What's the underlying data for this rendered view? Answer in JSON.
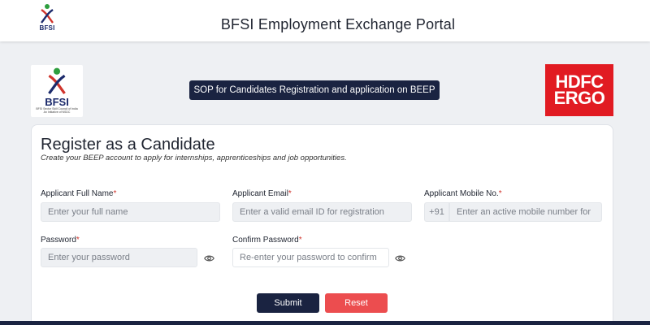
{
  "header": {
    "logo_text": "BFSI",
    "title": "BFSI Employment Exchange Portal"
  },
  "banner": {
    "bfsi_logo_text": "BFSI",
    "bfsi_tagline_line1": "BFSI Sector Skill Council of India",
    "bfsi_tagline_line2": "An Initiative of NSDC",
    "sop_label": "SOP for Candidates Registration and application on BEEP",
    "partner_logo_line1": "HDFC",
    "partner_logo_line2": "ERGO"
  },
  "form": {
    "title": "Register as a Candidate",
    "subtitle": "Create your BEEP account to apply for internships, apprenticeships and job opportunities.",
    "full_name": {
      "label": "Applicant Full Name",
      "placeholder": "Enter your full name",
      "value": ""
    },
    "email": {
      "label": "Applicant Email",
      "placeholder": "Enter a valid email ID for registration",
      "value": ""
    },
    "mobile": {
      "label": "Applicant Mobile No.",
      "prefix": "+91",
      "placeholder": "Enter an active mobile number for",
      "value": ""
    },
    "password": {
      "label": "Password",
      "placeholder": "Enter your password",
      "value": ""
    },
    "confirm_password": {
      "label": "Confirm Password",
      "placeholder": "Re-enter your password to confirm",
      "value": ""
    },
    "required_marker": "*",
    "submit_label": "Submit",
    "reset_label": "Reset"
  },
  "colors": {
    "primary_navy": "#1a2341",
    "reset_red": "#ec4d4f",
    "partner_red": "#e11b22",
    "required_red": "#d0342c",
    "page_bg": "#eef0f3"
  },
  "icons": {
    "password_toggle": "eye-icon",
    "confirm_password_toggle": "eye-icon"
  }
}
